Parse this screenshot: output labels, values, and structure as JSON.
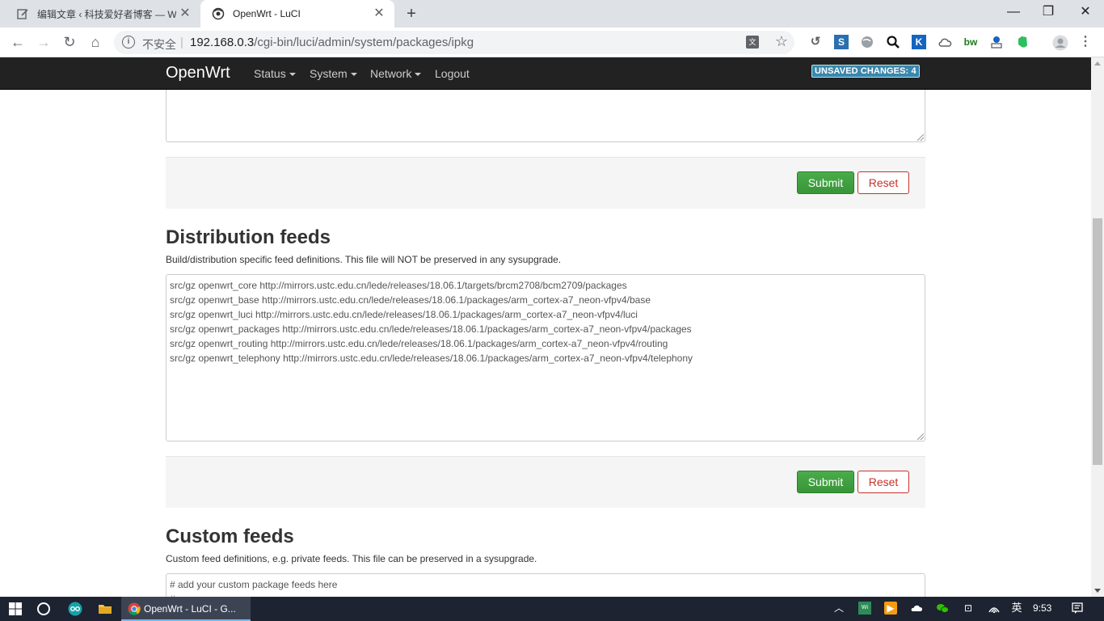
{
  "browser": {
    "tabs": [
      {
        "title": "编辑文章 ‹ 科技爱好者博客 — W",
        "close": "✕"
      },
      {
        "title": "OpenWrt - LuCI",
        "close": "✕"
      }
    ],
    "new_tab": "+",
    "window_controls": {
      "minimize": "—",
      "maximize": "❐",
      "close": "✕"
    },
    "insecure_label": "不安全",
    "url_host": "192.168.0.3",
    "url_path": "/cgi-bin/luci/admin/system/packages/ipkg",
    "url_separator": "|"
  },
  "luci": {
    "brand": "OpenWrt",
    "menu": [
      {
        "label": "Status"
      },
      {
        "label": "System"
      },
      {
        "label": "Network"
      },
      {
        "label": "Logout"
      }
    ],
    "unsaved_badge": "UNSAVED CHANGES: 4"
  },
  "sections": {
    "top_form": {
      "submit": "Submit",
      "reset": "Reset"
    },
    "distribution": {
      "title": "Distribution feeds",
      "description": "Build/distribution specific feed definitions. This file will NOT be preserved in any sysupgrade.",
      "feeds": [
        "src/gz openwrt_core http://mirrors.ustc.edu.cn/lede/releases/18.06.1/targets/brcm2708/bcm2709/packages",
        "src/gz openwrt_base http://mirrors.ustc.edu.cn/lede/releases/18.06.1/packages/arm_cortex-a7_neon-vfpv4/base",
        "src/gz openwrt_luci http://mirrors.ustc.edu.cn/lede/releases/18.06.1/packages/arm_cortex-a7_neon-vfpv4/luci",
        "src/gz openwrt_packages http://mirrors.ustc.edu.cn/lede/releases/18.06.1/packages/arm_cortex-a7_neon-vfpv4/packages",
        "src/gz openwrt_routing http://mirrors.ustc.edu.cn/lede/releases/18.06.1/packages/arm_cortex-a7_neon-vfpv4/routing",
        "src/gz openwrt_telephony http://mirrors.ustc.edu.cn/lede/releases/18.06.1/packages/arm_cortex-a7_neon-vfpv4/telephony"
      ],
      "submit": "Submit",
      "reset": "Reset"
    },
    "custom": {
      "title": "Custom feeds",
      "description": "Custom feed definitions, e.g. private feeds. This file can be preserved in a sysupgrade.",
      "content_line1": "# add your custom package feeds here",
      "content_line2": "#"
    }
  },
  "taskbar": {
    "app_title": "OpenWrt - LuCI - G...",
    "ime": "英",
    "time": "9:53"
  },
  "colors": {
    "navbar": "#222222",
    "submit": "#3f9a3f",
    "reset": "#c9302c",
    "badge": "#3a87ad"
  }
}
